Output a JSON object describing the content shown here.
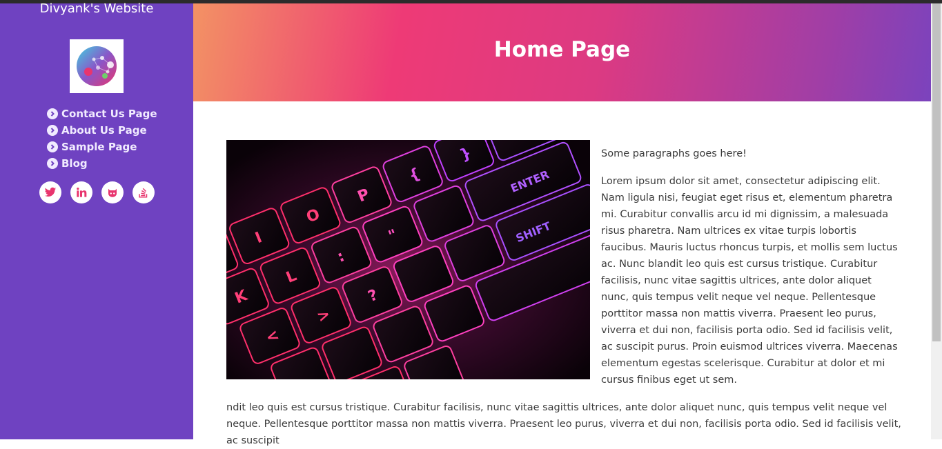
{
  "sidebar": {
    "site_title": "Divyank's Website",
    "nav": [
      {
        "label": "Contact Us Page"
      },
      {
        "label": "About Us Page"
      },
      {
        "label": "Sample Page"
      },
      {
        "label": "Blog"
      }
    ],
    "social": [
      "twitter-icon",
      "linkedin-icon",
      "github-icon",
      "stackoverflow-icon"
    ]
  },
  "header": {
    "title": "Home Page"
  },
  "main": {
    "intro": "Some paragraphs goes here!",
    "paragraph": "Lorem ipsum dolor sit amet, consectetur adipiscing elit. Nam ligula nisi, feugiat eget risus et, elementum pharetra mi. Curabitur convallis arcu id mi dignissim, a malesuada risus pharetra. Nam ultrices ex vitae turpis lobortis faucibus. Mauris luctus rhoncus turpis, et mollis sem luctus ac. Nunc blandit leo quis est cursus tristique. Curabitur facilisis, nunc vitae sagittis ultrices, ante dolor aliquet nunc, quis tempus velit neque vel neque. Pellentesque porttitor massa non mattis viverra. Praesent leo purus, viverra et dui non, facilisis porta odio. Sed id facilisis velit, ac suscipit purus. Proin euismod ultrices viverra. Maecenas elementum egestas scelerisque. Curabitur at dolor et mi cursus finibus eget ut sem.",
    "continuation": "ndit leo quis est cursus tristique. Curabitur facilisis, nunc vitae sagittis ultrices, ante dolor aliquet nunc, quis tempus velit neque vel neque. Pellentesque porttitor massa non mattis viverra. Praesent leo purus, viverra et dui non, facilisis porta odio. Sed id facilisis velit, ac suscipit"
  },
  "colors": {
    "sidebar": "#6f42c1",
    "accent": "#ee3a76",
    "gradient_start": "#f39264",
    "gradient_end": "#7b43bd"
  }
}
